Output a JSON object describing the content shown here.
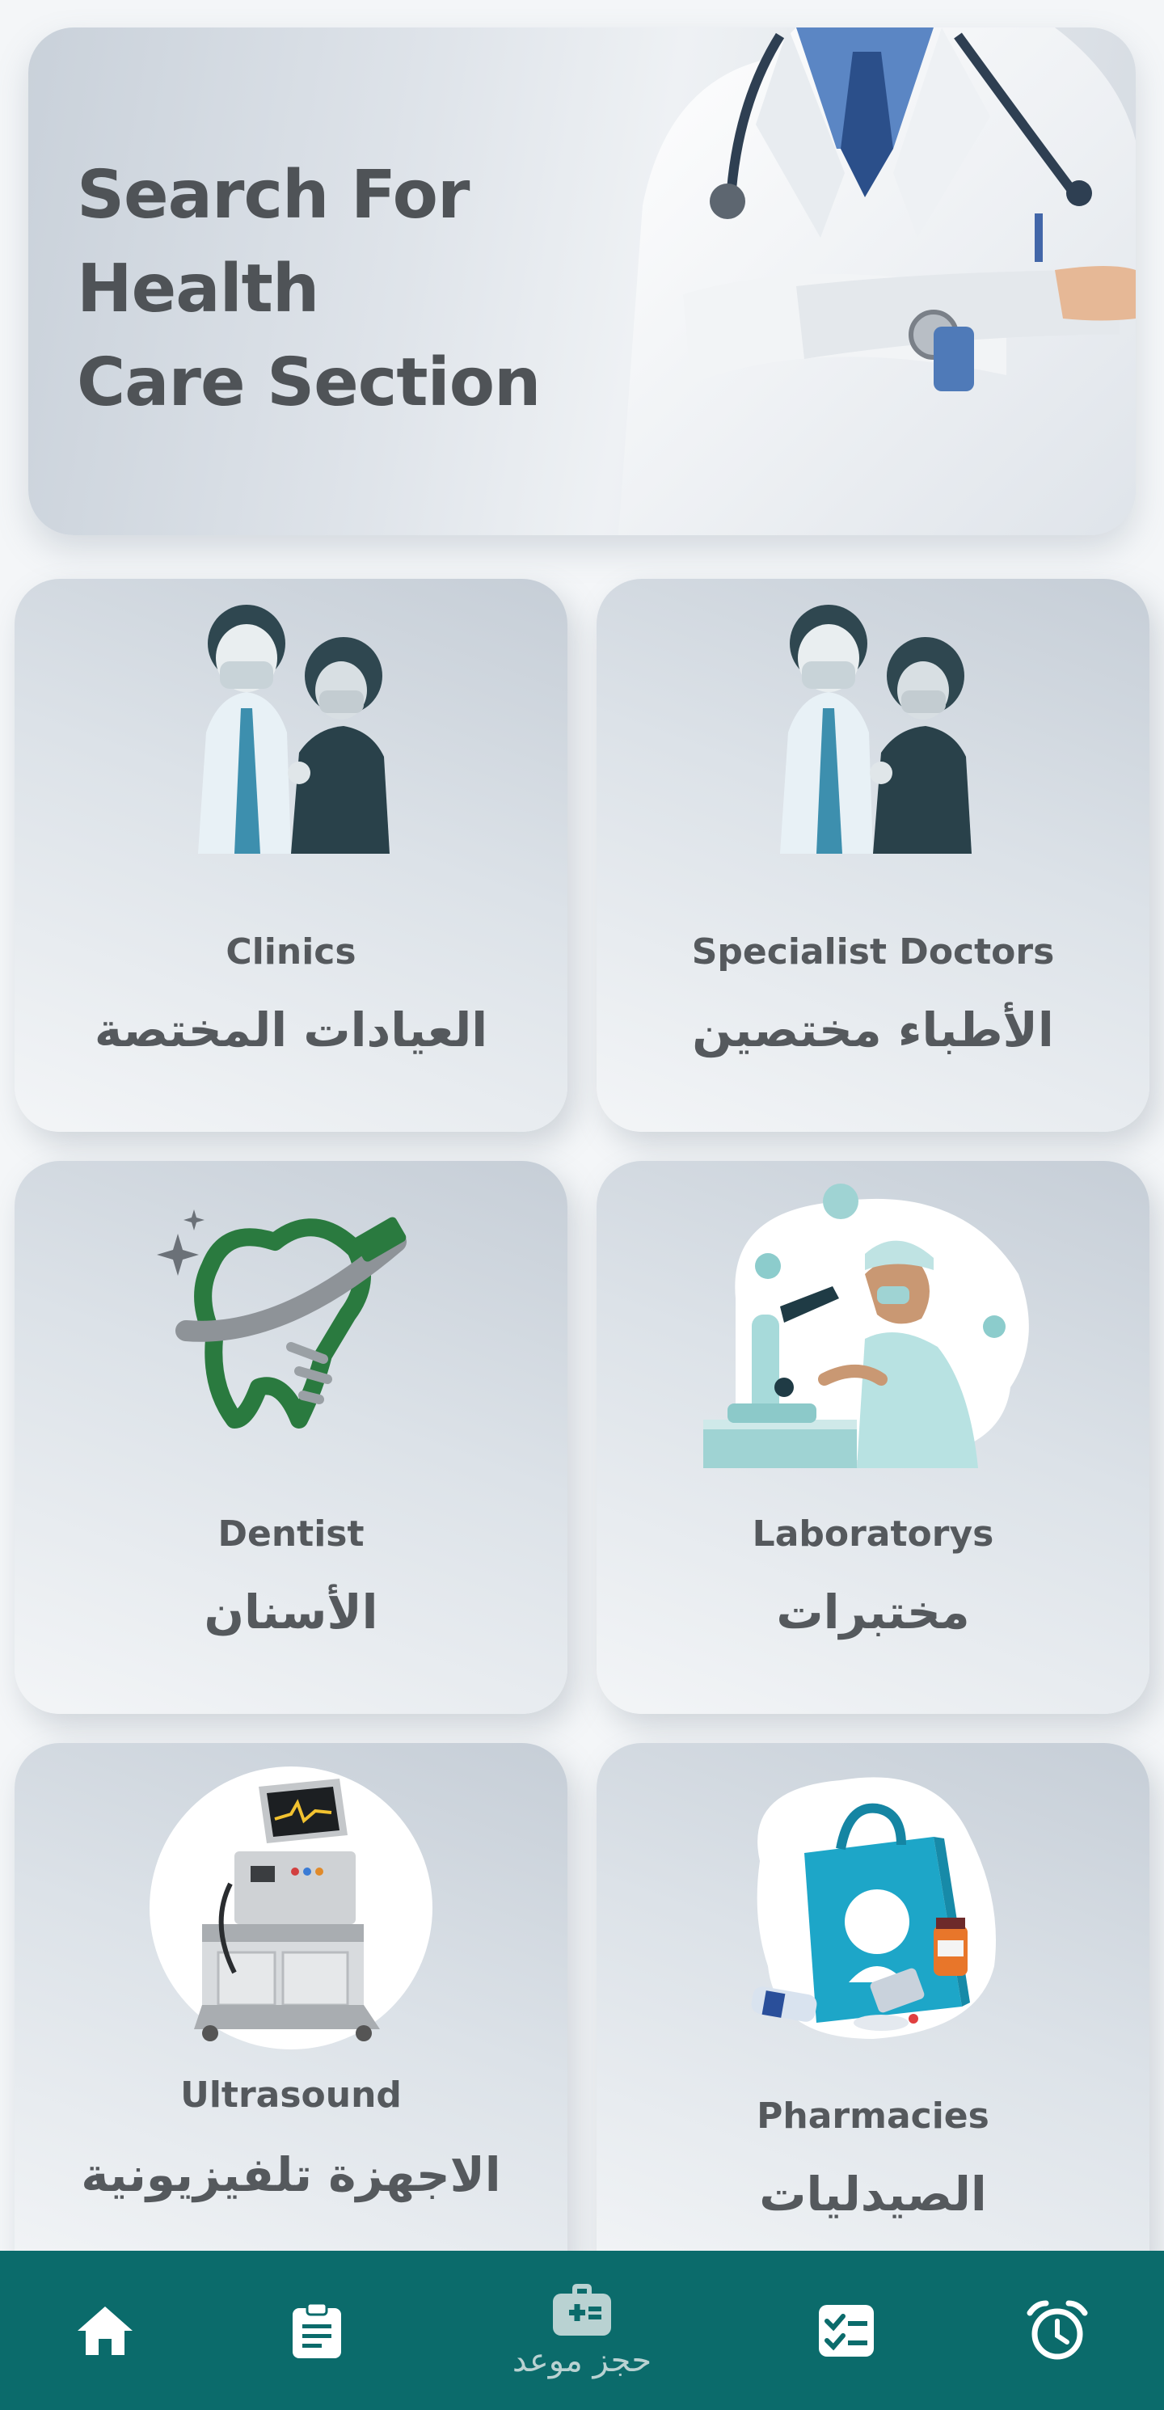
{
  "hero": {
    "title": "Search For\n Health\n Care Section"
  },
  "cards": [
    {
      "en": "Clinics",
      "ar": "العيادات المختصة",
      "icon": "doctor-patient-icon"
    },
    {
      "en": "Specialist Doctors",
      "ar": "الأطباء مختصين",
      "icon": "doctor-patient-icon"
    },
    {
      "en": "Dentist",
      "ar": "الأسنان",
      "icon": "tooth-icon"
    },
    {
      "en": "Laboratorys",
      "ar": "مختبرات",
      "icon": "microscope-scientist-icon"
    },
    {
      "en": "Ultrasound",
      "ar": "الاجهزة تلفيزيونية",
      "icon": "ultrasound-machine-icon"
    },
    {
      "en": "Pharmacies",
      "ar": "الصيدليات",
      "icon": "pharmacy-bag-icon"
    }
  ],
  "nav": {
    "items": [
      {
        "icon": "home-icon"
      },
      {
        "icon": "clipboard-icon"
      },
      {
        "icon": "medical-bag-icon",
        "label": "حجز موعد"
      },
      {
        "icon": "checklist-icon"
      },
      {
        "icon": "alarm-clock-icon"
      }
    ]
  },
  "colors": {
    "nav_bg": "#0b6b6b",
    "nav_icon": "#ffffff",
    "nav_label": "#b9d2d2",
    "text": "#55595d"
  }
}
